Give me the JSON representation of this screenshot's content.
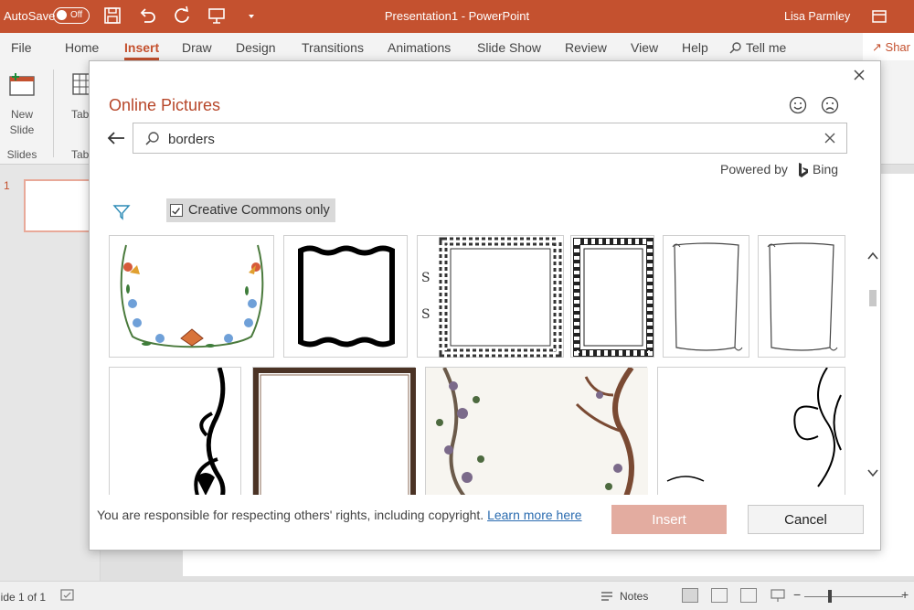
{
  "titlebar": {
    "autosave_label": "AutoSave",
    "autosave_state": "Off",
    "doc_title": "Presentation1  -  PowerPoint",
    "user": "Lisa Parmley",
    "bg_color": "#c4512f"
  },
  "ribbon": {
    "tabs": [
      "File",
      "Home",
      "Insert",
      "Draw",
      "Design",
      "Transitions",
      "Animations",
      "Slide Show",
      "Review",
      "View",
      "Help"
    ],
    "tell_me": "Tell me",
    "share": "Shar",
    "active_tab": "Insert",
    "new_slide_label": "New",
    "new_slide_label2": "Slide",
    "group_slides": "Slides",
    "table_label": "Tab",
    "group_tables": "Tabl"
  },
  "slides_pane": {
    "slide_number": "1"
  },
  "dialog": {
    "title": "Online Pictures",
    "search_value": "borders",
    "powered_by": "Powered by",
    "bing": "Bing",
    "creative_commons": "Creative Commons only",
    "creative_commons_checked": true,
    "footer_text": "You are responsible for respecting others' rights, including copyright. ",
    "footer_link": "Learn more here",
    "insert_button": "Insert",
    "cancel_button": "Cancel",
    "accent_color": "#b7472a"
  },
  "statusbar": {
    "slide_info": "lide 1 of 1",
    "notes": "Notes"
  }
}
